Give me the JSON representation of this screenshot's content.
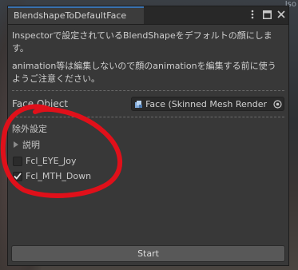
{
  "background": {
    "corner_label": "Iso"
  },
  "window": {
    "tab_title": "BlendshapeToDefaultFace",
    "description": "Inspectorで設定されているBlendShapeをデフォルトの顔にします。",
    "warning": "animation等は編集しないので顔のanimationを編集する前に使うようご注意ください。",
    "face_object": {
      "label": "Face Object",
      "value": "Face (Skinned Mesh Render"
    },
    "exclude": {
      "title": "除外設定",
      "foldout_label": "説明",
      "items": [
        {
          "label": "Fcl_EYE_Joy",
          "checked": false
        },
        {
          "label": "Fcl_MTH_Down",
          "checked": true
        }
      ]
    },
    "start_label": "Start"
  },
  "colors": {
    "accent": "#3a72b0",
    "annotation": "#e0101a"
  }
}
